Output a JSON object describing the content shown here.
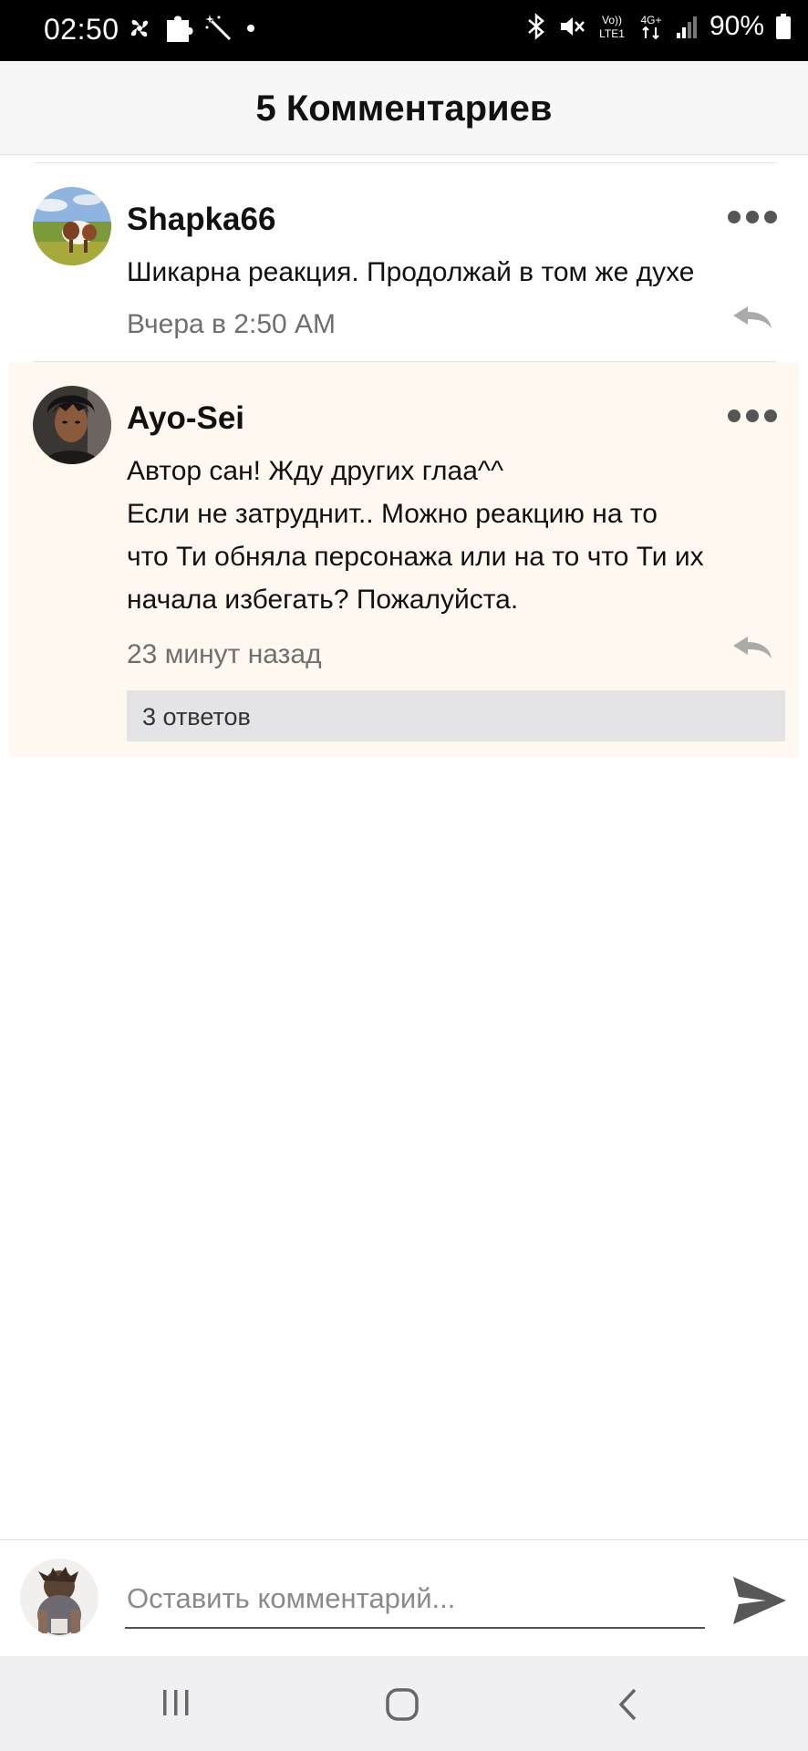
{
  "status_bar": {
    "time": "02:50",
    "battery": "90%",
    "left_icons": [
      "pinwheel-icon",
      "puzzle-icon",
      "magic-wand-icon",
      "dot-icon"
    ],
    "right_icons": [
      "bluetooth-icon",
      "mute-icon",
      "volte-icon",
      "4g-icon",
      "signal-icon",
      "battery-icon"
    ],
    "volte_label": "Vo)) LTE1",
    "network_label": "4G+"
  },
  "header": {
    "title": "5 Комментариев"
  },
  "comments": [
    {
      "author": "Shapka66",
      "text": "Шикарна реакция. Продолжай в том же духе",
      "time": "Вчера в 2:50 AM",
      "avatar": "cow-field-avatar"
    },
    {
      "author": "Ayo-Sei",
      "text_lines": [
        "Автор сан! Жду других глаа^^",
        "Если не затруднит.. Можно реакцию на то",
        "что Ти обняла персонажа или на то что Ти их",
        "начала избегать? Пожалуйста."
      ],
      "time": "23 минут назад",
      "replies": "3 ответов",
      "avatar": "anime-boy-avatar",
      "highlight_color": "#fff8f1"
    }
  ],
  "input": {
    "placeholder": "Оставить комментарий...",
    "value": ""
  },
  "colors": {
    "header_bg": "#f7f7f7",
    "highlight_bg": "#fff8f1",
    "replies_bg": "#e4e4e7",
    "muted_text": "#6f6f6f",
    "icon_gray": "#555555"
  }
}
